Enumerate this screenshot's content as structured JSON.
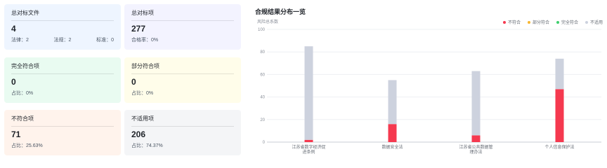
{
  "cards": {
    "total_files": {
      "title": "总对标文件",
      "value": "4",
      "foot": [
        "法律：2",
        "法规：2",
        "标准：0"
      ]
    },
    "total_items": {
      "title": "总对标项",
      "value": "277",
      "foot": [
        "合格率：0%"
      ]
    },
    "full_compliance": {
      "title": "完全符合项",
      "value": "0",
      "foot": [
        "占比：0%"
      ]
    },
    "partial_compliance": {
      "title": "部分符合项",
      "value": "0",
      "foot": [
        "占比：0%"
      ]
    },
    "non_compliance": {
      "title": "不符合项",
      "value": "71",
      "foot": [
        "占比：25.63%"
      ]
    },
    "not_applicable": {
      "title": "不适用项",
      "value": "206",
      "foot": [
        "占比：74.37%"
      ]
    }
  },
  "chart_data": {
    "type": "bar",
    "title": "合规结果分布一览",
    "ylabel": "风险总系数",
    "ylim": [
      0,
      100
    ],
    "yticks": [
      0,
      20,
      40,
      60,
      80,
      100
    ],
    "categories": [
      [
        "江苏省数字经济促",
        "进条例"
      ],
      [
        "数据安全法"
      ],
      [
        "江苏省公共数据管",
        "理办法"
      ],
      [
        "个人信息保护法"
      ]
    ],
    "series": [
      {
        "name": "不符合",
        "color": "#f5394f",
        "values": [
          2,
          16,
          6,
          47
        ]
      },
      {
        "name": "部分符合",
        "color": "#f7b731",
        "values": [
          0,
          0,
          0,
          0
        ]
      },
      {
        "name": "完全符合",
        "color": "#3ecf6e",
        "values": [
          0,
          0,
          0,
          0
        ]
      },
      {
        "name": "不适用",
        "color": "#cdd2de",
        "values": [
          83,
          39,
          57,
          27
        ]
      }
    ],
    "stacked": true,
    "legend_position": "top-right"
  }
}
